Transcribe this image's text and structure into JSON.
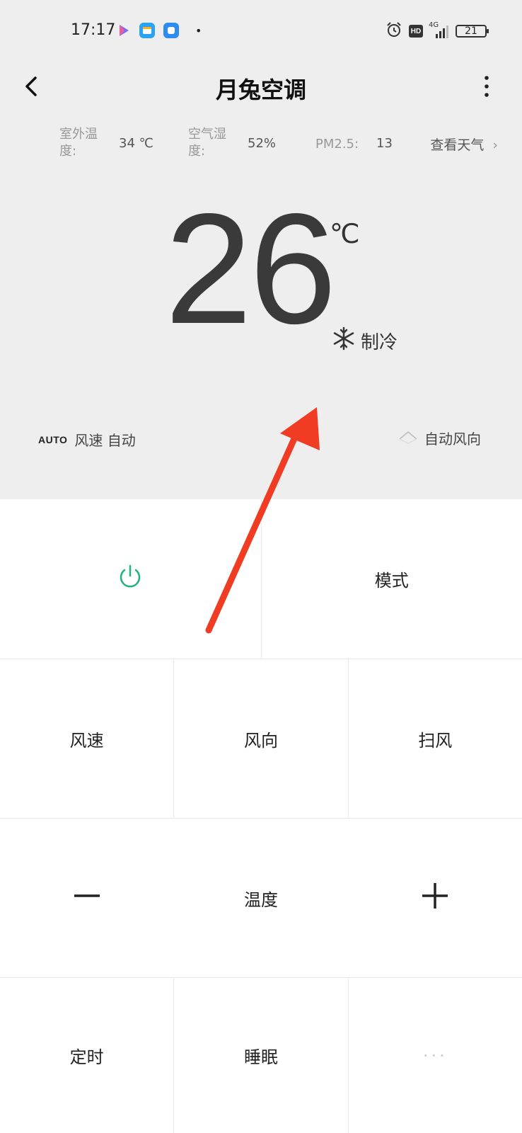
{
  "status_bar": {
    "time": "17:17",
    "network": "4G",
    "hd_badge": "HD",
    "battery": "21"
  },
  "header": {
    "title": "月兔空调"
  },
  "environment": {
    "outdoor_label": "室外温度:",
    "outdoor_value": "34 ℃",
    "humidity_label": "空气湿度:",
    "humidity_value": "52%",
    "pm_label": "PM2.5:",
    "pm_value": "13",
    "weather_link": "查看天气"
  },
  "display": {
    "temperature": "26",
    "unit": "℃",
    "mode": "制冷"
  },
  "status_line": {
    "fan_badge": "AUTO",
    "fan_text": "风速 自动",
    "swing_text": "自动风向"
  },
  "controls": {
    "mode": "模式",
    "fan_speed": "风速",
    "direction": "风向",
    "sweep": "扫风",
    "temperature": "温度",
    "timer": "定时",
    "sleep": "睡眠",
    "more": "···"
  },
  "colors": {
    "power_green": "#1fb27a",
    "arrow_red": "#f03c22",
    "top_bg": "#eeeeee"
  }
}
